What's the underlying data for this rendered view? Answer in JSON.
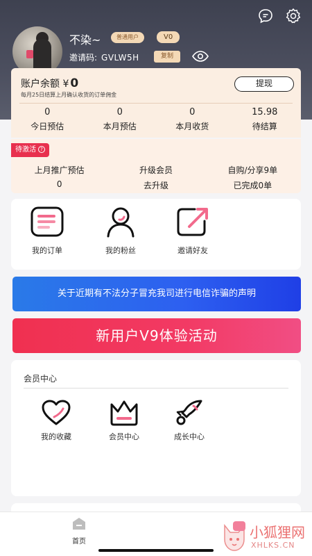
{
  "profile": {
    "name": "不染~",
    "member_badge": "普通用户",
    "level_badge": "V0",
    "invite_label": "邀请码:",
    "invite_code": "GVLW5H",
    "copy_label": "复制"
  },
  "balance": {
    "label": "账户余额 ¥",
    "amount": "0",
    "note": "每月25日结算上月确认收货的订单佣金",
    "withdraw_label": "提现",
    "stats": [
      {
        "value": "0",
        "label": "今日预估"
      },
      {
        "value": "0",
        "label": "本月预估"
      },
      {
        "value": "0",
        "label": "本月收货"
      },
      {
        "value": "15.98",
        "label": "待结算"
      }
    ]
  },
  "pending": {
    "tag": "待激活",
    "headers": [
      "上月推广预估",
      "升级会员",
      "自购/分享9单"
    ],
    "values": [
      "0",
      "去升级",
      "已完成0单"
    ]
  },
  "quick_links": [
    {
      "label": "我的订单",
      "icon": "orders-icon"
    },
    {
      "label": "我的粉丝",
      "icon": "fans-icon"
    },
    {
      "label": "邀请好友",
      "icon": "invite-icon"
    }
  ],
  "notice_banner": "关于近期有不法分子冒充我司进行电信诈骗的声明",
  "promo_banner": "新用户V9体验活动",
  "member_center": {
    "title": "会员中心",
    "items": [
      {
        "label": "我的收藏",
        "icon": "heart-icon"
      },
      {
        "label": "会员中心",
        "icon": "crown-icon"
      },
      {
        "label": "成长中心",
        "icon": "rocket-icon"
      }
    ]
  },
  "tabbar": {
    "home_label": "首页"
  },
  "watermark": {
    "title": "小狐狸网",
    "sub": "XHLKS.CN"
  },
  "colors": {
    "header": "#3e4150",
    "accent_pink": "#e8304e",
    "notice_blue": "#2d5ff0",
    "card_cream": "#fbeee2"
  }
}
